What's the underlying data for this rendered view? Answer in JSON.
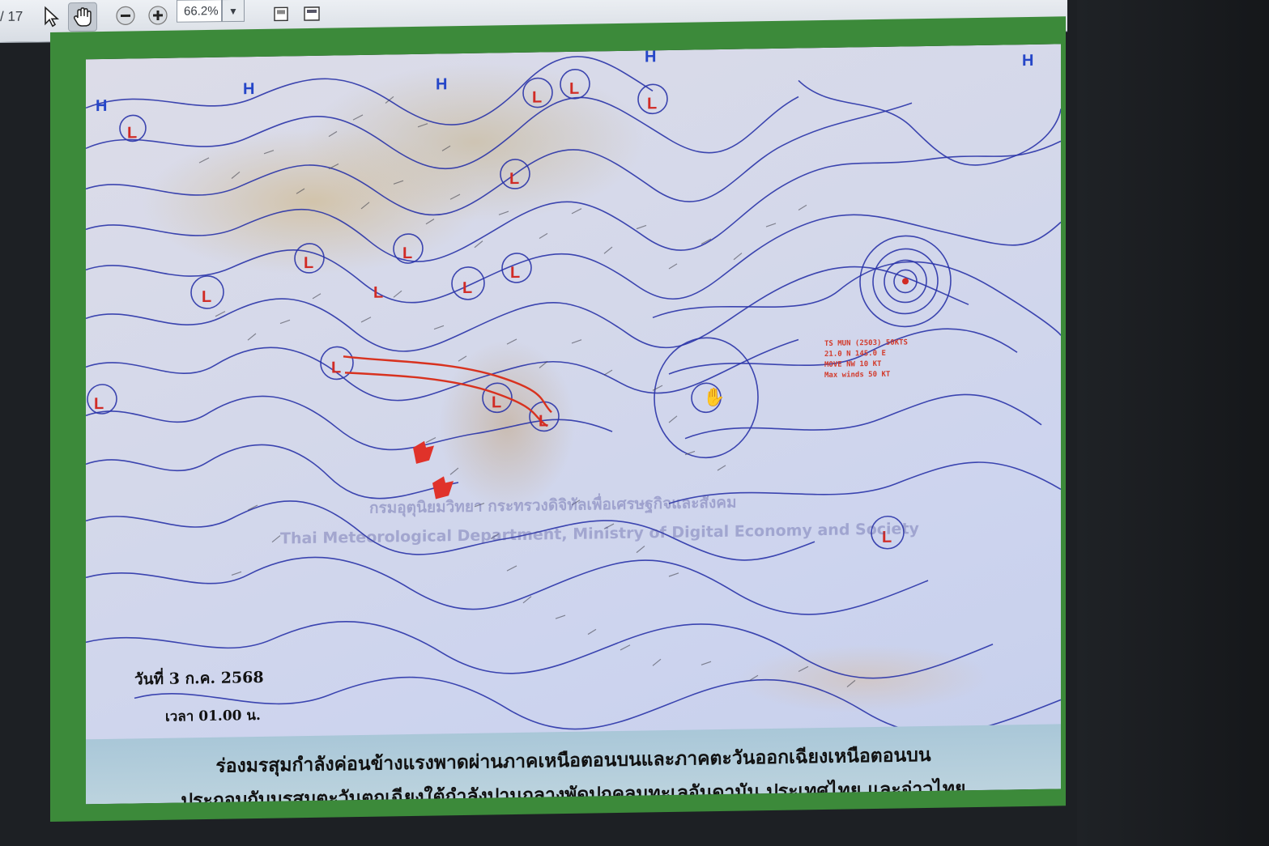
{
  "toolbar": {
    "page_count": "/ 17",
    "select_tool_icon": "select-arrow-icon",
    "hand_tool_icon": "hand-icon",
    "zoom_out_icon": "zoom-out-icon",
    "zoom_in_icon": "zoom-in-icon",
    "zoom_value": "66.2%"
  },
  "map": {
    "date_text": "วันที่ 3 ก.ค. 2568",
    "time_text": "เวลา 01.00 น.",
    "watermark_line1": "กรมอุตุนิยมวิทยา กระทรวงดิจิทัลเพื่อเศรษฐกิจและสังคม",
    "watermark_line2": "Thai Meteorological Department, Ministry of Digital Economy and Society",
    "storm_info": [
      "TS MUN (2503) 50KTS",
      "21.0 N 145.0 E",
      "MOVE NW 10 KT",
      "Max winds 50 KT"
    ],
    "pressure_high_label": "H",
    "pressure_low_label": "L",
    "caption_line1": "ร่องมรสุมกำลังค่อนข้างแรงพาดผ่านภาคเหนือตอนบนและภาคตะวันออกเฉียงเหนือตอนบน",
    "caption_line2": "ประกอบกับมรสุมตะวันตกเฉียงใต้กำลังปานกลางพัดปกคลุมทะเลอันดามัน ประเทศไทย และอ่าวไทย",
    "colors": {
      "isobar": "#2a34a8",
      "high": "#2546c8",
      "low": "#d12b25",
      "trough": "#d8321f",
      "frame": "#3c8a3a"
    }
  }
}
